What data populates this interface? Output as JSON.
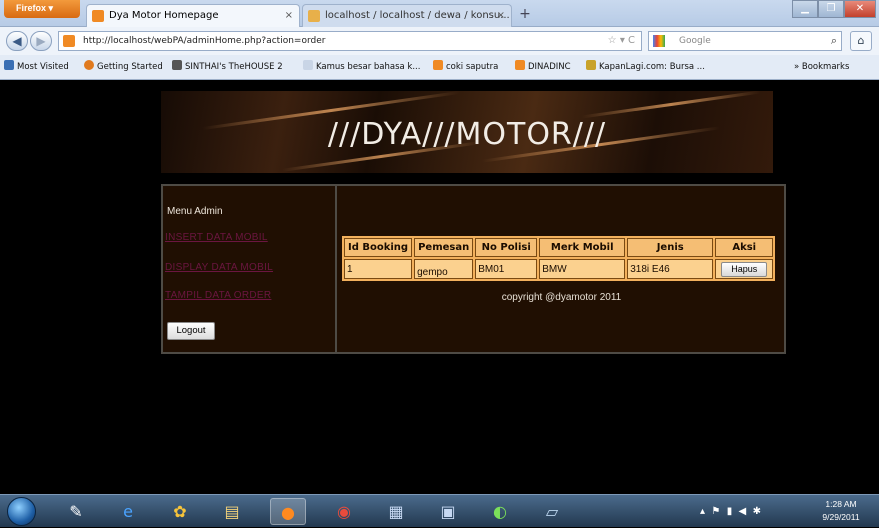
{
  "browser": {
    "app_button": "Firefox ▾",
    "tabs": [
      {
        "title": "Dya Motor Homepage",
        "close": "×"
      },
      {
        "title": "localhost / localhost / dewa / konsu...",
        "close": "×"
      }
    ],
    "new_tab": "+",
    "url": "http://localhost/webPA/adminHome.php?action=order",
    "search_placeholder": "Google",
    "bookmarks": [
      "Most Visited",
      "Getting Started",
      "SINTHAI's TheHOUSE 2",
      "Kamus besar bahasa k...",
      "coki saputra",
      "DINADINC",
      "KapanLagi.com: Bursa ...",
      "» Bookmarks"
    ]
  },
  "page": {
    "banner_title": "///DYA///MOTOR///",
    "menu": {
      "title": "Menu Admin",
      "links": [
        "INSERT DATA MOBIL",
        "DISPLAY DATA MOBIL",
        "TAMPIL DATA ORDER"
      ],
      "logout": "Logout"
    },
    "table": {
      "headers": [
        "Id Booking",
        "Pemesan",
        "No Polisi",
        "Merk Mobil",
        "Jenis",
        "Aksi"
      ],
      "rows": [
        {
          "id": "1",
          "pemesan": "gempo",
          "no_polisi": "BM01",
          "merk": "BMW",
          "jenis": "318i E46",
          "aksi": "Hapus"
        }
      ]
    },
    "copyright": "copyright @dyamotor 2011"
  },
  "taskbar": {
    "time": "1:28 AM",
    "date": "9/29/2011"
  }
}
